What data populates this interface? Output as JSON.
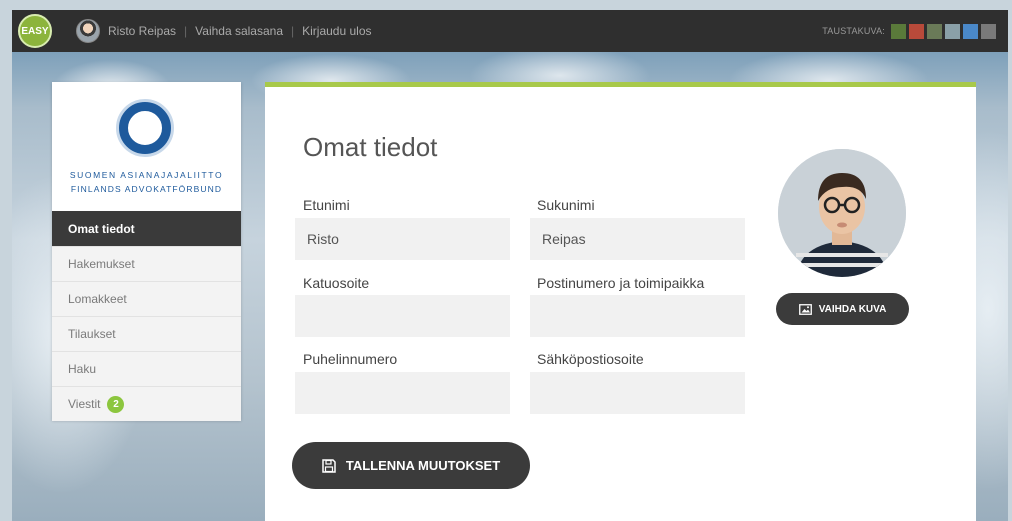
{
  "topbar": {
    "logo_text": "EASY",
    "user_name": "Risto Reipas",
    "change_password": "Vaihda salasana",
    "logout": "Kirjaudu ulos",
    "separator": "|",
    "background_label": "TAUSTAKUVA:",
    "swatch_colors": [
      "#5a7a3a",
      "#b84a3a",
      "#6a7a58",
      "#8aa0a8",
      "#4a88c8",
      "#7a7a7a"
    ]
  },
  "organization": {
    "name_fi": "SUOMEN ASIANAJAJALIITTO",
    "name_sv": "FINLANDS ADVOKATFÖRBUND",
    "brand_color": "#1e5a9c"
  },
  "sidebar": {
    "items": [
      {
        "label": "Omat tiedot",
        "active": true
      },
      {
        "label": "Hakemukset",
        "active": false
      },
      {
        "label": "Lomakkeet",
        "active": false
      },
      {
        "label": "Tilaukset",
        "active": false
      },
      {
        "label": "Haku",
        "active": false
      },
      {
        "label": "Viestit",
        "active": false,
        "badge": "2"
      }
    ]
  },
  "form": {
    "title": "Omat tiedot",
    "first_name": {
      "label": "Etunimi",
      "value": "Risto"
    },
    "last_name": {
      "label": "Sukunimi",
      "value": "Reipas"
    },
    "street_address": {
      "label": "Katuosoite",
      "value": ""
    },
    "postal": {
      "label": "Postinumero ja toimipaikka",
      "value": ""
    },
    "phone": {
      "label": "Puhelinnumero",
      "value": ""
    },
    "email": {
      "label": "Sähköpostiosoite",
      "value": ""
    },
    "save_label": "TALLENNA MUUTOKSET",
    "change_photo_label": "VAIHDA KUVA"
  },
  "colors": {
    "accent": "#a8c94a",
    "badge": "#8cc63e",
    "dark_button": "#3b3b3b"
  }
}
